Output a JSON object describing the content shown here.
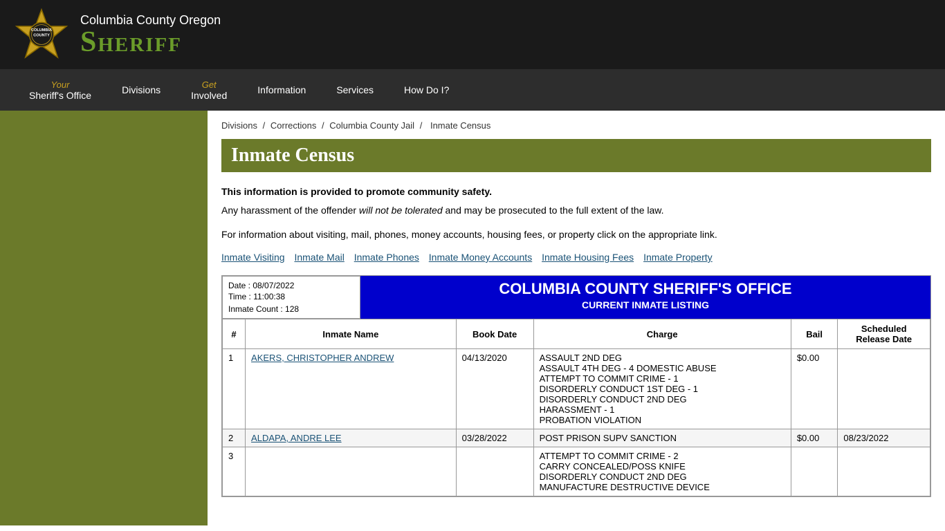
{
  "header": {
    "subtitle": "Columbia County Oregon",
    "title": "Sheriff",
    "logo_alt": "Columbia County Sheriff Badge"
  },
  "nav": {
    "items": [
      {
        "top": "Your",
        "bottom": "Sheriff's Office",
        "href": "#"
      },
      {
        "top": "",
        "bottom": "Divisions",
        "href": "#"
      },
      {
        "top": "Get",
        "bottom": "Involved",
        "href": "#"
      },
      {
        "top": "",
        "bottom": "Information",
        "href": "#"
      },
      {
        "top": "",
        "bottom": "Services",
        "href": "#"
      },
      {
        "top": "",
        "bottom": "How Do I?",
        "href": "#"
      }
    ]
  },
  "breadcrumb": {
    "items": [
      "Divisions",
      "Corrections",
      "Columbia County Jail",
      "Inmate Census"
    ]
  },
  "page_title": "Inmate Census",
  "info_notice": {
    "bold_text": "This information is provided to promote community safety.",
    "regular_text": "Any harassment of the offender will not be tolerated and may be prosecuted to the full extent of the law.",
    "link_text": "For information about visiting, mail, phones, money accounts, housing fees, or property click on the appropriate link."
  },
  "info_links": [
    "Inmate Visiting",
    "Inmate Mail",
    "Inmate Phones",
    "Inmate Money Accounts",
    "Inmate Housing Fees",
    "Inmate Property"
  ],
  "table_meta": {
    "date_label": "Date :",
    "date_value": "08/07/2022",
    "time_label": "Time :",
    "time_value": "11:00:38",
    "count_label": "Inmate Count :",
    "count_value": "128"
  },
  "table_header": {
    "agency_name": "COLUMBIA COUNTY SHERIFF'S OFFICE",
    "listing_type": "CURRENT INMATE LISTING"
  },
  "table_columns": [
    "#",
    "Inmate Name",
    "Book Date",
    "Charge",
    "Bail",
    "Scheduled Release Date"
  ],
  "inmates": [
    {
      "num": "1",
      "name": "AKERS, CHRISTOPHER ANDREW",
      "book_date": "04/13/2020",
      "charges": "ASSAULT 2ND DEG\nASSAULT 4TH DEG - 4 DOMESTIC ABUSE\nATTEMPT TO COMMIT CRIME - 1\nDISORDERLY CONDUCT 1ST DEG - 1\nDISORDERLY CONDUCT 2ND DEG\nHARASSMENT - 1\nPROBATION VIOLATION",
      "bail": "$0.00",
      "release_date": ""
    },
    {
      "num": "2",
      "name": "ALDAPA, ANDRE LEE",
      "book_date": "03/28/2022",
      "charges": "POST PRISON SUPV SANCTION",
      "bail": "$0.00",
      "release_date": "08/23/2022"
    },
    {
      "num": "3",
      "name": "",
      "book_date": "",
      "charges": "ATTEMPT TO COMMIT CRIME - 2\nCARRY CONCEALED/POSS KNIFE\nDISORDERLY CONDUCT 2ND DEG\nMANUFACTURE DESTRUCTIVE DEVICE",
      "bail": "",
      "release_date": ""
    }
  ]
}
